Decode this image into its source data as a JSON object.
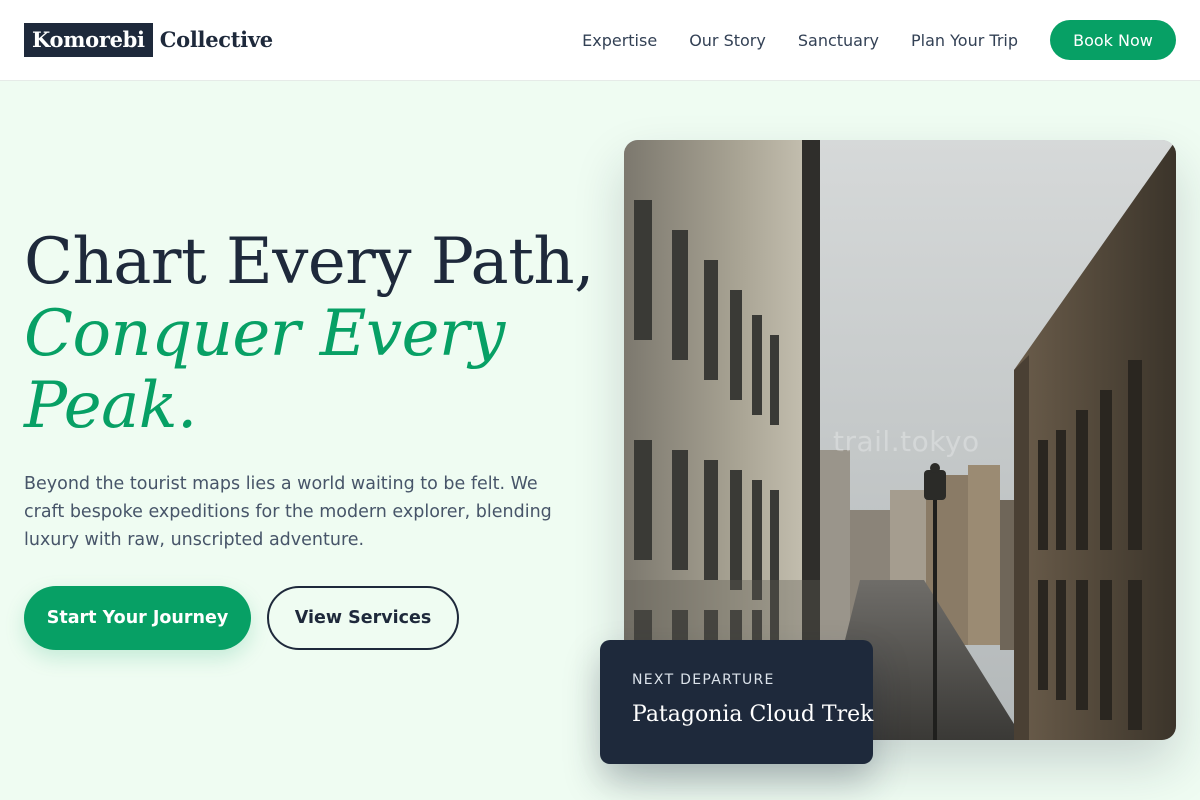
{
  "brand": {
    "logo_box": "Komorebi",
    "logo_rest": "Collective"
  },
  "nav": {
    "items": [
      {
        "label": "Expertise"
      },
      {
        "label": "Our Story"
      },
      {
        "label": "Sanctuary"
      },
      {
        "label": "Plan Your Trip"
      }
    ],
    "cta_label": "Book Now"
  },
  "hero": {
    "title_line1": "Chart Every Path,",
    "title_line2": "Conquer Every",
    "title_line3": "Peak.",
    "description": "Beyond the tourist maps lies a world waiting to be felt. We craft bespoke expeditions for the modern explorer, blending luxury with raw, unscripted adventure.",
    "primary_cta": "Start Your Journey",
    "secondary_cta": "View Services"
  },
  "photo": {
    "caption": "trail.tokyo"
  },
  "departure_card": {
    "label": "NEXT DEPARTURE",
    "title": "Patagonia Cloud Trek"
  },
  "colors": {
    "accent": "#07a065",
    "dark": "#1e293b",
    "background": "#effcf2"
  }
}
